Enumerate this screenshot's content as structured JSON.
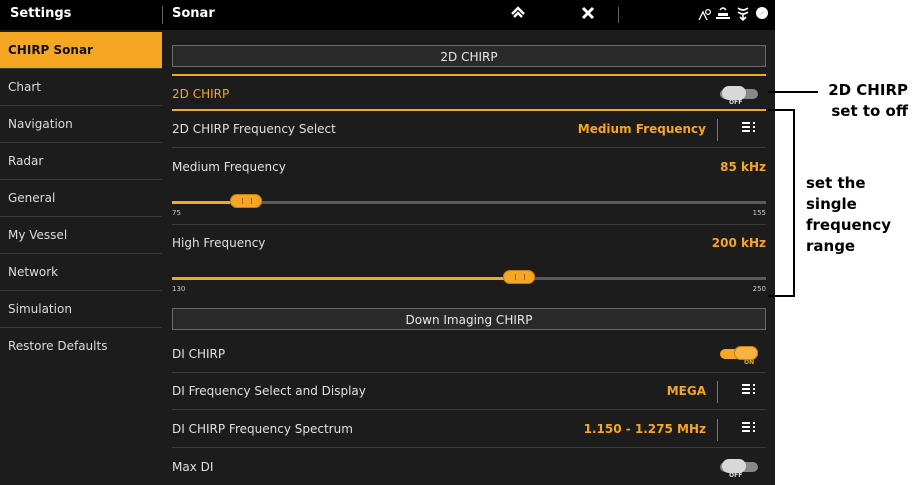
{
  "topbar": {
    "left_title": "Settings",
    "page_title": "Sonar"
  },
  "sidebar": {
    "items": [
      {
        "label": "CHIRP Sonar",
        "active": true
      },
      {
        "label": "Chart"
      },
      {
        "label": "Navigation"
      },
      {
        "label": "Radar"
      },
      {
        "label": "General"
      },
      {
        "label": "My Vessel"
      },
      {
        "label": "Network"
      },
      {
        "label": "Simulation"
      },
      {
        "label": "Restore Defaults"
      }
    ]
  },
  "main": {
    "section_2d": "2D CHIRP",
    "row_2d_chirp": {
      "label": "2D CHIRP",
      "toggle_state": "OFF"
    },
    "row_2d_freq_select": {
      "label": "2D CHIRP Frequency Select",
      "value": "Medium Frequency"
    },
    "row_medium_freq": {
      "label": "Medium Frequency",
      "value": "85 kHz"
    },
    "slider_medium": {
      "min": "75",
      "max": "155",
      "value": 85
    },
    "row_high_freq": {
      "label": "High Frequency",
      "value": "200 kHz"
    },
    "slider_high": {
      "min": "130",
      "max": "250",
      "value": 200
    },
    "section_di": "Down Imaging CHIRP",
    "row_di_chirp": {
      "label": "DI CHIRP",
      "toggle_state": "ON"
    },
    "row_di_freq_select": {
      "label": "DI Frequency Select and Display",
      "value": "MEGA"
    },
    "row_di_spectrum": {
      "label": "DI CHIRP Frequency Spectrum",
      "value": "1.150 - 1.275 MHz"
    },
    "row_max_di": {
      "label": "Max DI",
      "toggle_state": "OFF"
    }
  },
  "annotations": {
    "callout1_line1": "2D CHIRP",
    "callout1_line2": "set to off",
    "callout2_line1": "set the single",
    "callout2_line2": "frequency",
    "callout2_line3": "range"
  },
  "colors": {
    "accent": "#f5a623",
    "background": "#1c1c1c",
    "topbar": "#000000"
  },
  "icons": [
    "home-icon",
    "close-icon",
    "gps-icon",
    "network-icon",
    "sonar-icon",
    "compass-icon",
    "menu-icon"
  ]
}
